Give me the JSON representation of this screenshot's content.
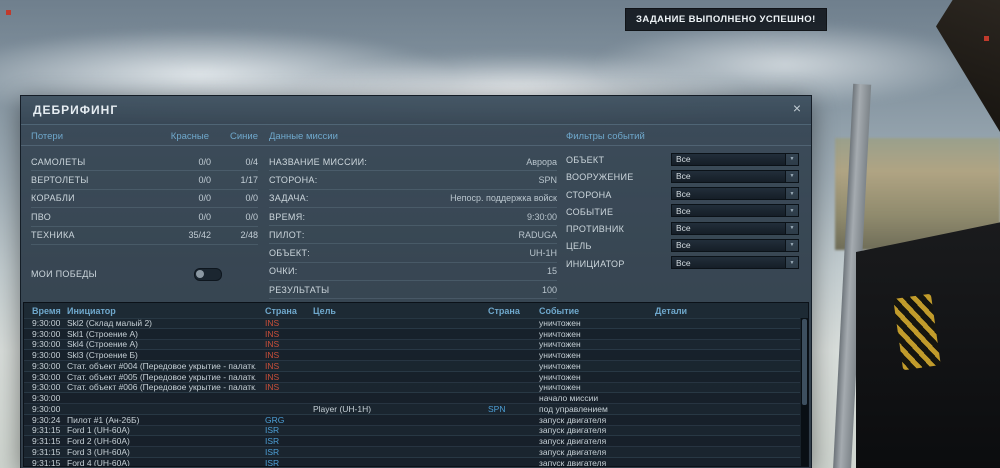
{
  "colors": {
    "accent": "#6fa8cc",
    "red_side": "#c94f3a",
    "blue_side": "#4d9fd6"
  },
  "banner": {
    "text": "ЗАДАНИЕ ВЫПОЛНЕНО УСПЕШНО!"
  },
  "dialog": {
    "title": "ДЕБРИФИНГ",
    "close": "×"
  },
  "losses": {
    "title": "Потери",
    "col_red": "Красные",
    "col_blue": "Синие",
    "my_victories_label": "МОИ ПОБЕДЫ",
    "rows": [
      {
        "label": "САМОЛЕТЫ",
        "red": "0/0",
        "blue": "0/4"
      },
      {
        "label": "ВЕРТОЛЕТЫ",
        "red": "0/0",
        "blue": "1/17"
      },
      {
        "label": "КОРАБЛИ",
        "red": "0/0",
        "blue": "0/0"
      },
      {
        "label": "ПВО",
        "red": "0/0",
        "blue": "0/0"
      },
      {
        "label": "ТЕХНИКА",
        "red": "35/42",
        "blue": "2/48"
      }
    ]
  },
  "mission": {
    "title": "Данные миссии",
    "rows": [
      {
        "label": "НАЗВАНИЕ МИССИИ:",
        "value": "Аврора"
      },
      {
        "label": "СТОРОНА:",
        "value": "SPN"
      },
      {
        "label": "ЗАДАЧА:",
        "value": "Непоср. поддержка войск"
      },
      {
        "label": "ВРЕМЯ:",
        "value": "9:30:00"
      },
      {
        "label": "ПИЛОТ:",
        "value": "RADUGA"
      },
      {
        "label": "ОБЪЕКТ:",
        "value": "UH-1H"
      },
      {
        "label": "ОЧКИ:",
        "value": "15"
      },
      {
        "label": "РЕЗУЛЬТАТЫ",
        "value": "100"
      }
    ]
  },
  "filters": {
    "title": "Фильтры событий",
    "rows": [
      {
        "label": "ОБЪЕКТ",
        "value": "Все"
      },
      {
        "label": "ВООРУЖЕНИЕ",
        "value": "Все"
      },
      {
        "label": "СТОРОНА",
        "value": "Все"
      },
      {
        "label": "СОБЫТИЕ",
        "value": "Все"
      },
      {
        "label": "ПРОТИВНИК",
        "value": "Все"
      },
      {
        "label": "ЦЕЛЬ",
        "value": "Все"
      },
      {
        "label": "ИНИЦИАТОР",
        "value": "Все"
      }
    ]
  },
  "events": {
    "headers": [
      "Время",
      "Инициатор",
      "Страна",
      "Цель",
      "Страна",
      "Событие",
      "Детали"
    ],
    "rows": [
      {
        "time": "9:30:00",
        "initiator": "Skl2 (Склад малый 2)",
        "initiator_country": "INS",
        "initiator_side": "red",
        "target": "",
        "target_country": "",
        "target_side": "",
        "event": "уничтожен",
        "details": ""
      },
      {
        "time": "9:30:00",
        "initiator": "Skl1 (Строение А)",
        "initiator_country": "INS",
        "initiator_side": "red",
        "target": "",
        "target_country": "",
        "target_side": "",
        "event": "уничтожен",
        "details": ""
      },
      {
        "time": "9:30:00",
        "initiator": "Skl4 (Строение А)",
        "initiator_country": "INS",
        "initiator_side": "red",
        "target": "",
        "target_country": "",
        "target_side": "",
        "event": "уничтожен",
        "details": ""
      },
      {
        "time": "9:30:00",
        "initiator": "Skl3 (Строение Б)",
        "initiator_country": "INS",
        "initiator_side": "red",
        "target": "",
        "target_country": "",
        "target_side": "",
        "event": "уничтожен",
        "details": ""
      },
      {
        "time": "9:30:00",
        "initiator": "Стат. объект #004 (Передовое укрытие - палатк.",
        "initiator_country": "INS",
        "initiator_side": "red",
        "target": "",
        "target_country": "",
        "target_side": "",
        "event": "уничтожен",
        "details": ""
      },
      {
        "time": "9:30:00",
        "initiator": "Стат. объект #005 (Передовое укрытие - палатк.",
        "initiator_country": "INS",
        "initiator_side": "red",
        "target": "",
        "target_country": "",
        "target_side": "",
        "event": "уничтожен",
        "details": ""
      },
      {
        "time": "9:30:00",
        "initiator": "Стат. объект #006 (Передовое укрытие - палатк.",
        "initiator_country": "INS",
        "initiator_side": "red",
        "target": "",
        "target_country": "",
        "target_side": "",
        "event": "уничтожен",
        "details": ""
      },
      {
        "time": "9:30:00",
        "initiator": "",
        "initiator_country": "",
        "initiator_side": "",
        "target": "",
        "target_country": "",
        "target_side": "",
        "event": "начало миссии",
        "details": ""
      },
      {
        "time": "9:30:00",
        "initiator": "",
        "initiator_country": "",
        "initiator_side": "",
        "target": "Player  (UH-1H)",
        "target_country": "SPN",
        "target_side": "blue",
        "event": "под управлением",
        "details": ""
      },
      {
        "time": "9:30:24",
        "initiator": "Пилот #1 (Ан-26Б)",
        "initiator_country": "GRG",
        "initiator_side": "blue",
        "target": "",
        "target_country": "",
        "target_side": "",
        "event": "запуск двигателя",
        "details": ""
      },
      {
        "time": "9:31:15",
        "initiator": "Ford 1 (UH-60A)",
        "initiator_country": "ISR",
        "initiator_side": "blue",
        "target": "",
        "target_country": "",
        "target_side": "",
        "event": "запуск двигателя",
        "details": ""
      },
      {
        "time": "9:31:15",
        "initiator": "Ford 2 (UH-60A)",
        "initiator_country": "ISR",
        "initiator_side": "blue",
        "target": "",
        "target_country": "",
        "target_side": "",
        "event": "запуск двигателя",
        "details": ""
      },
      {
        "time": "9:31:15",
        "initiator": "Ford 3 (UH-60A)",
        "initiator_country": "ISR",
        "initiator_side": "blue",
        "target": "",
        "target_country": "",
        "target_side": "",
        "event": "запуск двигателя",
        "details": ""
      },
      {
        "time": "9:31:15",
        "initiator": "Ford 4 (UH-60A)",
        "initiator_country": "ISR",
        "initiator_side": "blue",
        "target": "",
        "target_country": "",
        "target_side": "",
        "event": "запуск двигателя",
        "details": ""
      }
    ]
  }
}
